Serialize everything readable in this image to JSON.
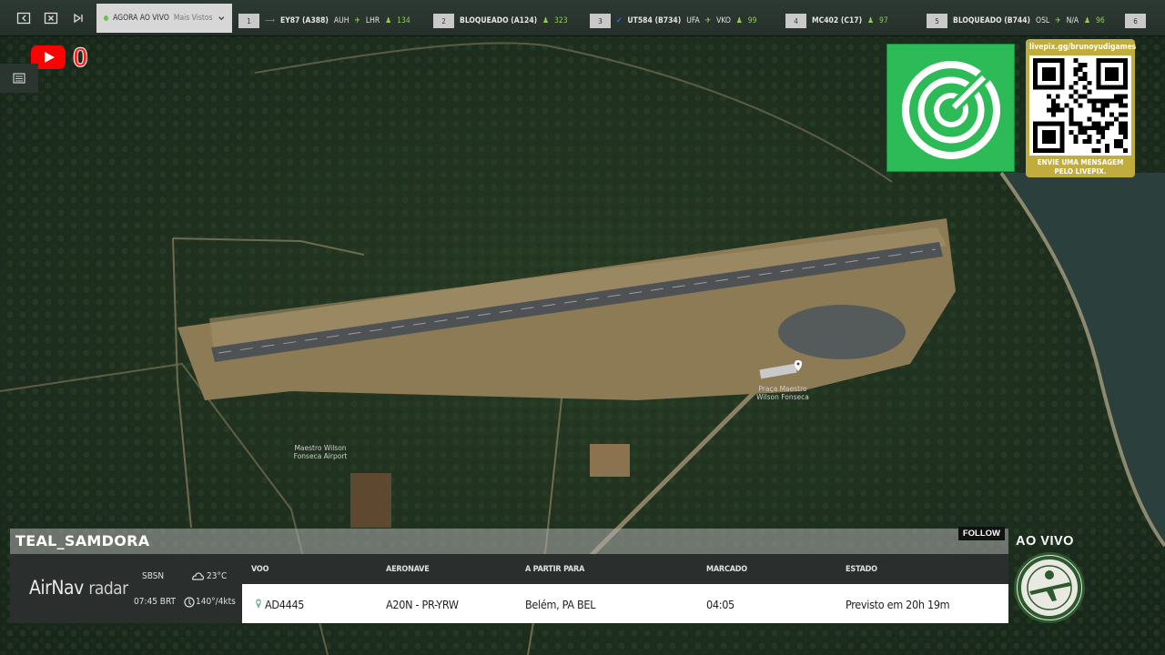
{
  "topbar": {
    "now_live_label": "AGORA AO VIVO",
    "now_live_filter": "Mais Vistos",
    "flights": [
      {
        "rank": "1",
        "flight": "EY87 (A388)",
        "from": "AUH",
        "to": "LHR",
        "altitude": "134"
      },
      {
        "rank": "2",
        "flight": "BLOQUEADO (A124)",
        "from": "",
        "to": "",
        "altitude": "323"
      },
      {
        "rank": "3",
        "flight": "UT584 (B734)",
        "from": "UFA",
        "to": "VKO",
        "altitude": "99"
      },
      {
        "rank": "4",
        "flight": "MC402 (C17)",
        "from": "",
        "to": "",
        "altitude": "97"
      },
      {
        "rank": "5",
        "flight": "BLOQUEADO (B744)",
        "from": "OSL",
        "to": "N/A",
        "altitude": "96"
      },
      {
        "rank": "6",
        "flight": "",
        "from": "",
        "to": "",
        "altitude": ""
      }
    ]
  },
  "youtube": {
    "count": "0"
  },
  "map": {
    "airport_label_1": "Maestro Wilson",
    "airport_label_2": "Fonseca Airport",
    "place_label_1": "Praça Maestro",
    "place_label_2": "Wilson Fonseca"
  },
  "qr": {
    "url": "livepix.gg/brunoyudigames",
    "message_1": "ENVIE UMA MENSAGEM",
    "message_2": "PELO LIVEPIX."
  },
  "panel": {
    "username": "TEAL_SAMDORA",
    "follow_label": "FOLLOW",
    "brand_main": "AirNav",
    "brand_sub": "radar",
    "weather": {
      "airport": "SBSN",
      "time": "07:45 BRT",
      "temperature": "23°C",
      "wind": "140°/4kts"
    },
    "columns": [
      "VOO",
      "AERONAVE",
      "A PARTIR PARA",
      "MARCADO",
      "ESTADO"
    ],
    "flight": {
      "code": "AD4445",
      "aircraft": "A20N - PR-YRW",
      "from_to": "Belém, PA BEL",
      "scheduled": "04:05",
      "status": "Previsto em 20h 19m"
    }
  },
  "live_label": "AO VIVO",
  "colors": {
    "ticker_green": "#8fd14f",
    "radar_green": "#2dbb58",
    "qr_gold": "#c0ad3d",
    "youtube_red": "#ff0000"
  }
}
